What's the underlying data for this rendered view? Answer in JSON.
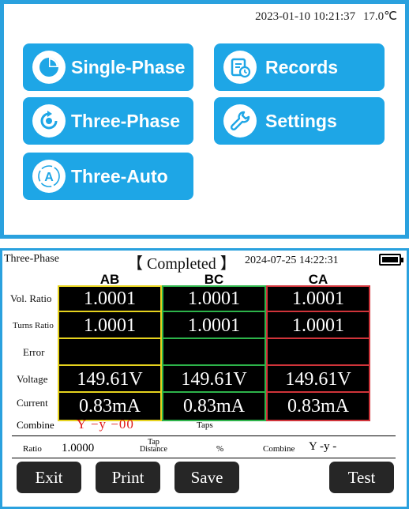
{
  "top_status": {
    "datetime": "2023-01-10 10:21:37",
    "temperature": "17.0℃"
  },
  "menu": {
    "single_phase": "Single-Phase",
    "records": "Records",
    "three_phase": "Three-Phase",
    "settings": "Settings",
    "three_auto": "Three-Auto"
  },
  "icons": {
    "single_phase": "pie-chart-icon",
    "records": "records-icon",
    "three_phase": "refresh-icon",
    "settings": "wrench-icon",
    "three_auto": "auto-a-icon"
  },
  "colors": {
    "accent": "#1ea6e6",
    "col_ab": "#e6d21e",
    "col_bc": "#2db34a",
    "col_ca": "#d0343a",
    "combine_red": "#e01818"
  },
  "test_screen": {
    "mode": "Three-Phase",
    "status": "【 Completed 】",
    "datetime": "2024-07-25 14:22:31",
    "columns": [
      "AB",
      "BC",
      "CA"
    ],
    "row_labels": [
      "Vol. Ratio",
      "Turns Ratio",
      "Error",
      "Voltage",
      "Current"
    ],
    "values": {
      "vol_ratio": [
        "1.0001",
        "1.0001",
        "1.0001"
      ],
      "turns_ratio": [
        "1.0001",
        "1.0001",
        "1.0001"
      ],
      "error": [
        "",
        "",
        ""
      ],
      "voltage": [
        "149.61V",
        "149.61V",
        "149.61V"
      ],
      "current": [
        "0.83mA",
        "0.83mA",
        "0.83mA"
      ]
    },
    "combine_label": "Combine",
    "combine_value": "Y −y −00",
    "taps_label": "Taps",
    "ratio_label": "Ratio",
    "ratio_value": "1.0000",
    "tap_label_1": "Tap",
    "tap_label_2": "Distance",
    "percent_label": "%",
    "combine2_label": "Combine",
    "combine2_value": "Y -y -",
    "buttons": {
      "exit": "Exit",
      "print": "Print",
      "save": "Save",
      "test": "Test"
    }
  }
}
